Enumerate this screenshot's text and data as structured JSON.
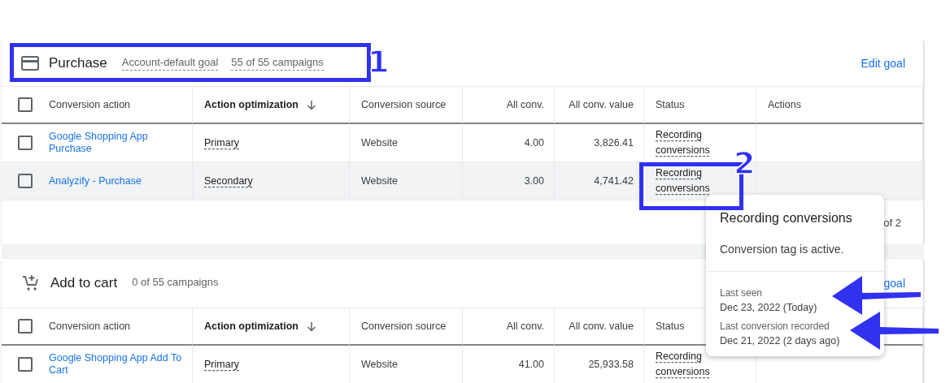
{
  "goals": [
    {
      "title": "Purchase",
      "tags": [
        {
          "text": "Account-default goal",
          "dashed": true
        },
        {
          "text": "55 of 55 campaigns",
          "dashed": true
        }
      ],
      "edit_link": "Edit goal",
      "select_all": false,
      "columns": [
        {
          "label": "Conversion action",
          "sorted": false
        },
        {
          "label": "Action optimization",
          "sorted": true
        },
        {
          "label": "Conversion source",
          "sorted": false
        },
        {
          "label": "All conv.",
          "sorted": false
        },
        {
          "label": "All conv. value",
          "sorted": false
        },
        {
          "label": "Status",
          "sorted": false
        },
        {
          "label": "Actions",
          "sorted": false
        }
      ],
      "rows": [
        {
          "checked": false,
          "hovered": false,
          "action": "Google Shopping App Purchase",
          "optimization": "Primary",
          "source": "Website",
          "all_conv": "4.00",
          "all_conv_value": "3,826.41",
          "status": "Recording conversions"
        },
        {
          "checked": false,
          "hovered": true,
          "action": "Analyzify - Purchase",
          "optimization": "Secondary",
          "source": "Website",
          "all_conv": "3.00",
          "all_conv_value": "4,741.42",
          "status": "Recording conversions"
        }
      ],
      "footer": "of 2"
    },
    {
      "title": "Add to cart",
      "tags": [
        {
          "text": "0 of 55 campaigns",
          "dashed": false
        }
      ],
      "edit_link": "goal",
      "select_all": false,
      "columns": [
        {
          "label": "Conversion action",
          "sorted": false
        },
        {
          "label": "Action optimization",
          "sorted": true
        },
        {
          "label": "Conversion source",
          "sorted": false
        },
        {
          "label": "All conv.",
          "sorted": false
        },
        {
          "label": "All conv. value",
          "sorted": false
        },
        {
          "label": "Status",
          "sorted": false
        }
      ],
      "rows": [
        {
          "checked": false,
          "hovered": false,
          "action": "Google Shopping App Add To Cart",
          "optimization": "Primary",
          "source": "Website",
          "all_conv": "41.00",
          "all_conv_value": "25,933.58",
          "status": "Recording conversions"
        }
      ]
    }
  ],
  "tooltip": {
    "title": "Recording conversions",
    "body": "Conversion tag is active.",
    "details": [
      {
        "label": "Last seen",
        "value": "Dec 23, 2022 (Today)"
      },
      {
        "label": "Last conversion recorded",
        "value": "Dec 21, 2022 (2 days ago)"
      }
    ]
  },
  "annotations": [
    {
      "kind": "box",
      "label": "1"
    },
    {
      "kind": "box",
      "label": "2"
    },
    {
      "kind": "arrow"
    },
    {
      "kind": "arrow"
    }
  ]
}
